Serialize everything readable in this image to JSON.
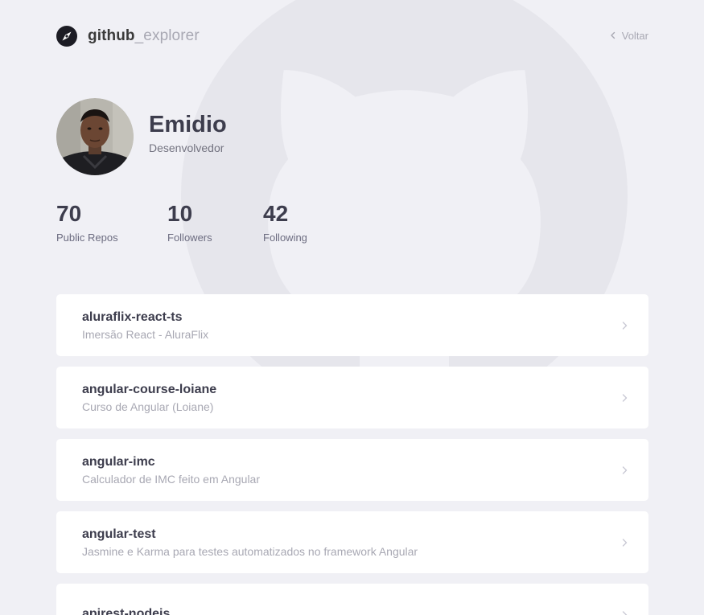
{
  "header": {
    "brand_strong": "github",
    "brand_light": "_explorer",
    "back_label": "Voltar"
  },
  "profile": {
    "name": "Emidio",
    "bio": "Desenvolvedor"
  },
  "stats": [
    {
      "value": "70",
      "label": "Public Repos"
    },
    {
      "value": "10",
      "label": "Followers"
    },
    {
      "value": "42",
      "label": "Following"
    }
  ],
  "repos": [
    {
      "name": "aluraflix-react-ts",
      "description": "Imersão React - AluraFlix"
    },
    {
      "name": "angular-course-loiane",
      "description": "Curso de Angular (Loiane)"
    },
    {
      "name": "angular-imc",
      "description": "Calculador de IMC feito em Angular"
    },
    {
      "name": "angular-test",
      "description": "Jasmine e Karma para testes automatizados no framework Angular"
    },
    {
      "name": "apirest-nodejs",
      "description": ""
    }
  ],
  "colors": {
    "background": "#f0f0f5",
    "card": "#ffffff",
    "title": "#3d3d4d",
    "muted": "#a8a8b3"
  },
  "icons": {
    "brand": "compass-icon",
    "back": "chevron-left-icon",
    "card": "chevron-right-icon",
    "background": "github-octocat-logo"
  }
}
